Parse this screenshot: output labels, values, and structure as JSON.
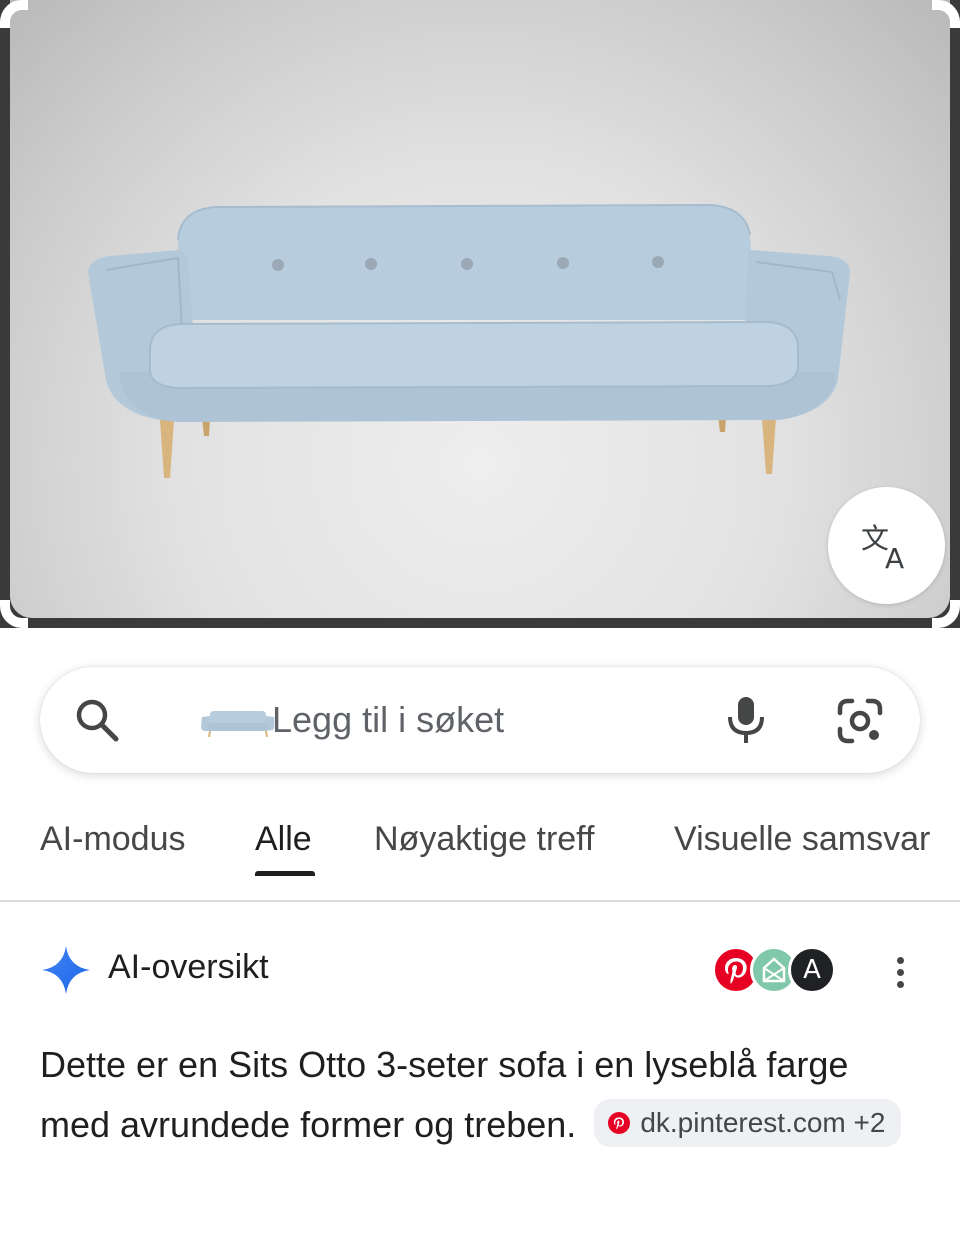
{
  "image_preview": {
    "description_icon": "sofa-image",
    "translate_icon": "translate-icon"
  },
  "search": {
    "placeholder": "Legg til i søket",
    "icons": [
      "search-icon",
      "sofa-thumbnail",
      "mic-icon",
      "lens-camera-icon"
    ]
  },
  "tabs": [
    {
      "label": "AI-modus",
      "active": false
    },
    {
      "label": "Alle",
      "active": true
    },
    {
      "label": "Nøyaktige treff",
      "active": false
    },
    {
      "label": "Visuelle samsvar",
      "active": false
    }
  ],
  "ai_overview": {
    "title": "AI-oversikt",
    "sources": [
      "pinterest-icon",
      "green-source-icon",
      "a-source-icon"
    ],
    "source_a_letter": "A",
    "text": "Dette er en Sits Otto 3-seter sofa i en lyseblå farge med avrundede former og treben.",
    "chip_label": "dk.pinterest.com +2"
  },
  "colors": {
    "accent_blue": "#4285f4",
    "sofa": "#b5cbdc",
    "pinterest": "#e60023",
    "text_primary": "#1f1f1f"
  }
}
